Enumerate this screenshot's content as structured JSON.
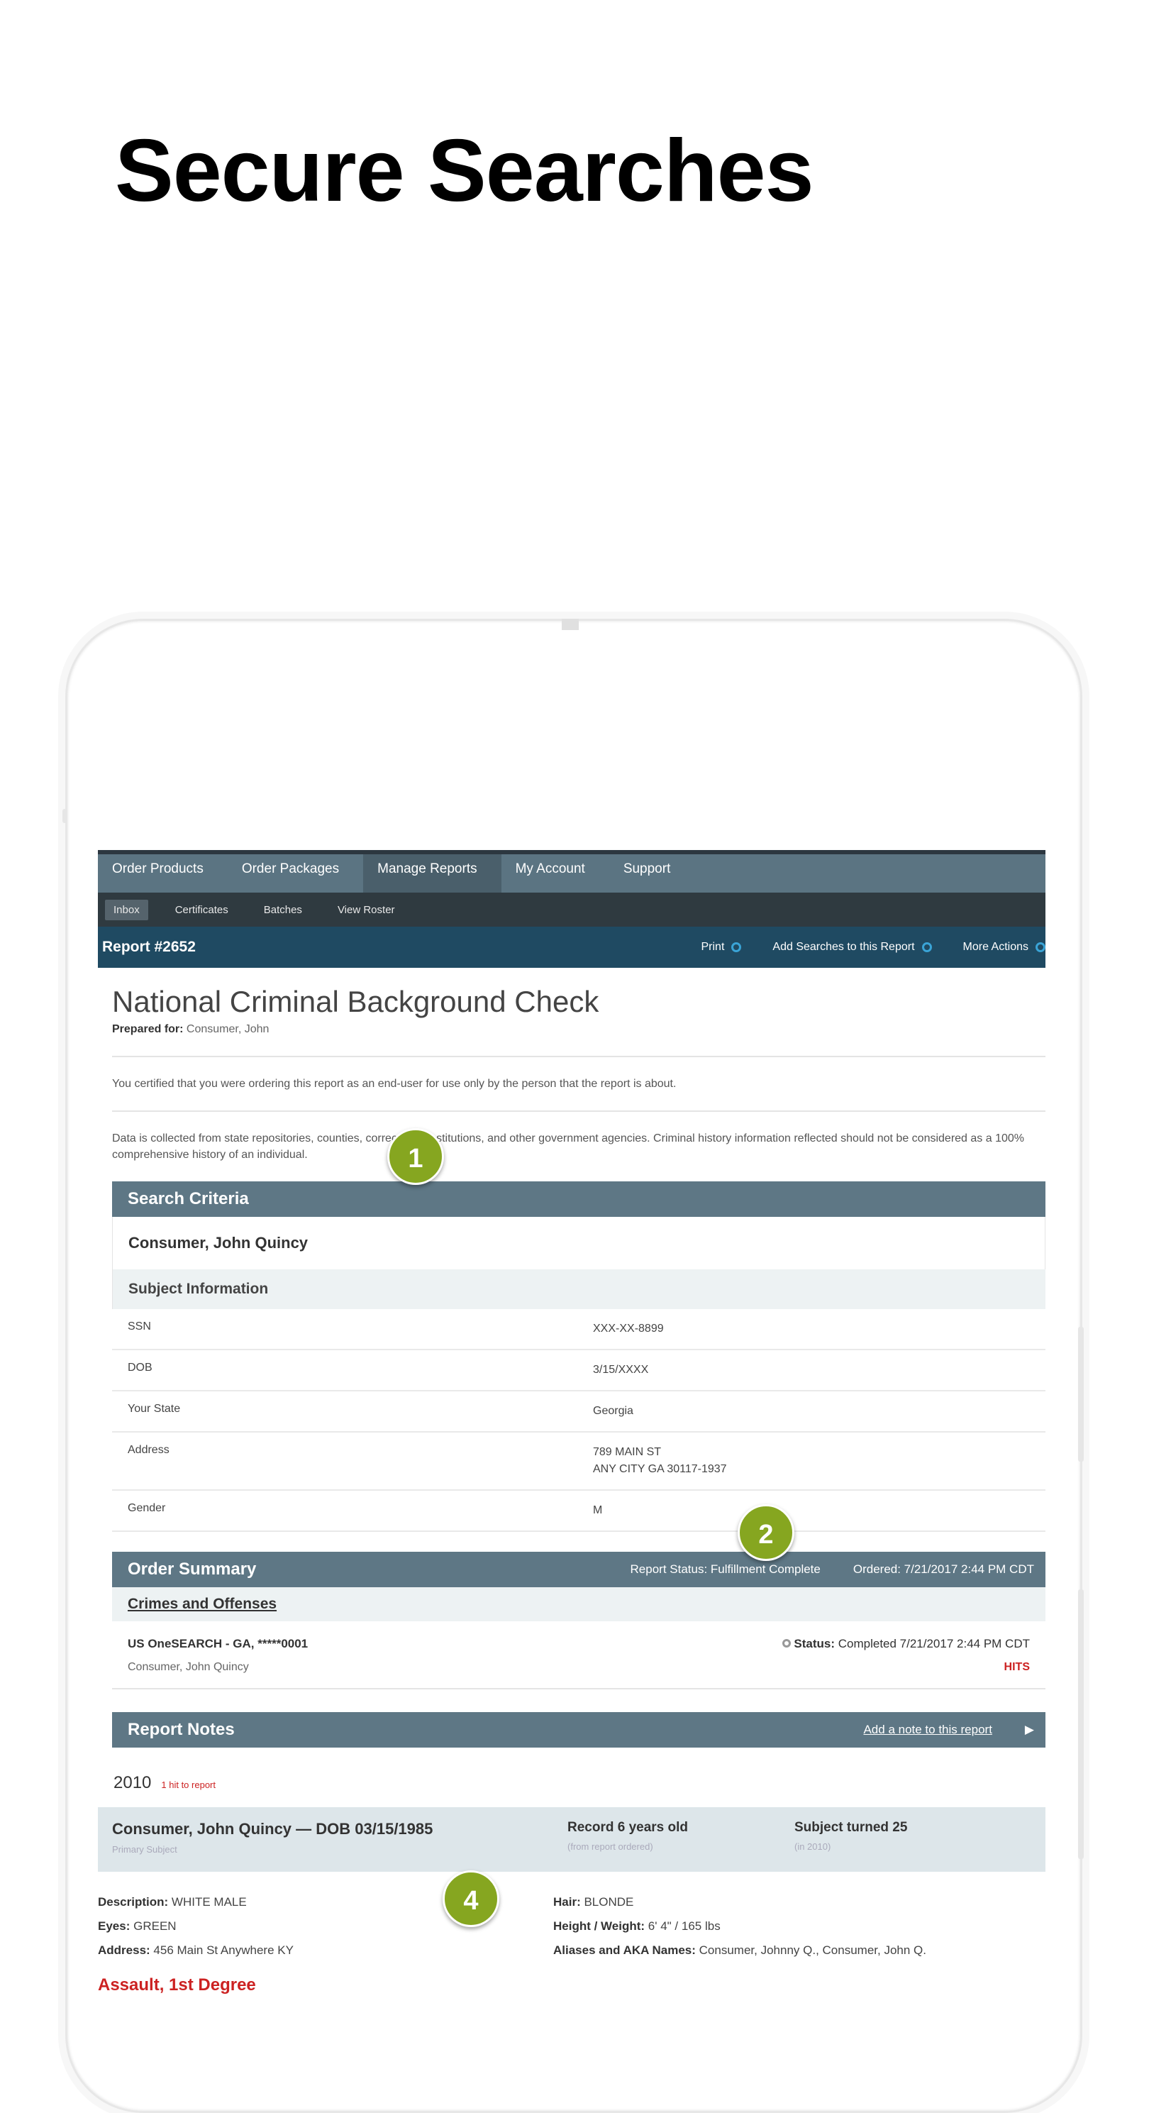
{
  "hero": {
    "title": "Secure Searches"
  },
  "nav": {
    "tabs": [
      "Order Products",
      "Order Packages",
      "Manage Reports",
      "My Account",
      "Support"
    ],
    "active_tab": "Manage Reports",
    "subtabs": [
      "Inbox",
      "Certificates",
      "Batches",
      "View Roster"
    ]
  },
  "report_bar": {
    "title": "Report #2652",
    "print": "Print",
    "add_searches": "Add Searches to this Report",
    "more_actions": "More Actions"
  },
  "report": {
    "heading": "National Criminal Background Check",
    "prepared_label": "Prepared for:",
    "prepared_value": "Consumer, John",
    "certification_note": "You certified that you were ordering this report as an end-user for use only by the person that the report is about.",
    "data_note": "Data is collected from state repositories, counties, correctional institutions, and other government agencies. Criminal history information reflected should not be considered as a 100% comprehensive history of an individual."
  },
  "search_criteria": {
    "heading": "Search Criteria",
    "subject_name": "Consumer, John Quincy",
    "subject_info_heading": "Subject Information",
    "rows": [
      {
        "label": "SSN",
        "value": "XXX-XX-8899"
      },
      {
        "label": "DOB",
        "value": "3/15/XXXX"
      },
      {
        "label": "Your State",
        "value": "Georgia"
      },
      {
        "label": "Address",
        "value": "789 MAIN ST\nANY CITY GA 30117-1937"
      },
      {
        "label": "Gender",
        "value": "M"
      }
    ]
  },
  "order_summary": {
    "heading": "Order Summary",
    "report_status": "Report Status: Fulfillment Complete",
    "ordered": "Ordered: 7/21/2017 2:44 PM CDT",
    "crimes_link": "Crimes and Offenses",
    "search_name": "US OneSEARCH - GA, *****0001",
    "status_label": "Status:",
    "status_value": "Completed 7/21/2017 2:44 PM CDT",
    "subject": "Consumer, John Quincy",
    "hits": "HITS"
  },
  "report_notes": {
    "heading": "Report Notes",
    "add_note": "Add a note to this report",
    "year": "2010",
    "year_hits": "1 hit to report",
    "record": {
      "title": "Consumer, John Quincy — DOB 03/15/1985",
      "subtitle": "Primary Subject",
      "age_title": "Record 6 years old",
      "age_sub": "(from report ordered)",
      "turned_title": "Subject turned 25",
      "turned_sub": "(in 2010)"
    },
    "details": {
      "description_label": "Description:",
      "description": "WHITE MALE",
      "eyes_label": "Eyes:",
      "eyes": "GREEN",
      "address_label": "Address:",
      "address": "456 Main St Anywhere KY",
      "hair_label": "Hair:",
      "hair": "BLONDE",
      "hw_label": "Height / Weight:",
      "hw": "6' 4\" / 165 lbs",
      "aliases_label": "Aliases and AKA Names:",
      "aliases": "Consumer, Johnny Q., Consumer, John Q."
    },
    "offense": "Assault, 1st Degree"
  },
  "badges": [
    "1",
    "2",
    "4"
  ],
  "colors": {
    "badge": "#86a620",
    "nav": "#5b7482",
    "report_bar": "#1f4a62",
    "hits": "#cc2222"
  }
}
